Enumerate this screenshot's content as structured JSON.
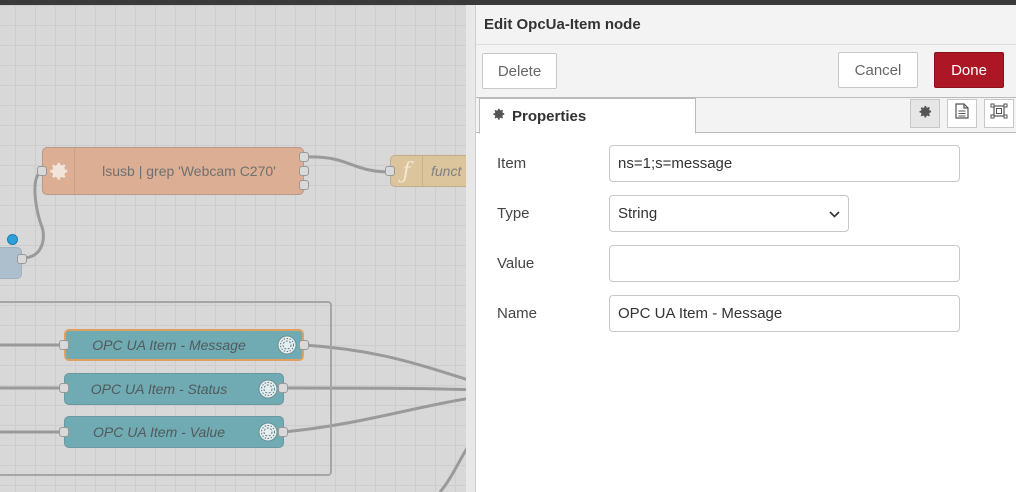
{
  "workspace": {
    "nodes": {
      "exec_label": "lsusb | grep 'Webcam C270'",
      "func_label": "funct",
      "opc_message": "OPC UA Item - Message",
      "opc_status": "OPC UA Item - Status",
      "opc_value": "OPC UA Item - Value"
    }
  },
  "tray": {
    "title": "Edit OpcUa-Item node",
    "buttons": {
      "delete": "Delete",
      "cancel": "Cancel",
      "done": "Done"
    },
    "tabs": {
      "properties": "Properties"
    },
    "form": {
      "item_label": "Item",
      "item_value": "ns=1;s=message",
      "type_label": "Type",
      "type_value": "String",
      "value_label": "Value",
      "value_value": "",
      "name_label": "Name",
      "name_value": "OPC UA Item - Message"
    }
  },
  "colors": {
    "done_button": "#ad1625",
    "opc_node": "#70aab2",
    "exec_node": "#dcae93",
    "function_node": "#dcc49c",
    "selected_outline": "#e0a060"
  },
  "icons": {
    "exec": "gear-icon",
    "function": "function-icon",
    "opc": "opcua-icon",
    "properties_tab": "gear-icon",
    "description_tab": "document-icon",
    "appearance_tab": "node-appearance-icon",
    "type_dropdown": "chevron-down-icon"
  }
}
